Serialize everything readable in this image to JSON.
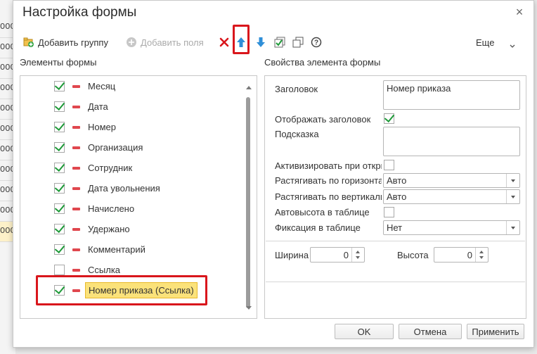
{
  "background": {
    "rows": [
      "OOC",
      "OOC",
      "OOC",
      "OOC",
      "OOC",
      "OOC",
      "OOC",
      "OOC",
      "OOC",
      "OOC",
      "OOC"
    ]
  },
  "dialog": {
    "title": "Настройка формы"
  },
  "toolbar": {
    "add_group": "Добавить группу",
    "add_fields": "Добавить поля",
    "more": "Еще",
    "icons": [
      "plus-folder-icon",
      "plus-circle-icon",
      "delete-x-icon",
      "move-up-arrow-icon",
      "move-down-arrow-icon",
      "check-all-icon",
      "copy-icon",
      "help-icon"
    ]
  },
  "left_panel": {
    "header": "Элементы формы",
    "items": [
      {
        "label": "Месяц",
        "checked": true
      },
      {
        "label": "Дата",
        "checked": true
      },
      {
        "label": "Номер",
        "checked": true
      },
      {
        "label": "Организация",
        "checked": true
      },
      {
        "label": "Сотрудник",
        "checked": true
      },
      {
        "label": "Дата увольнения",
        "checked": true
      },
      {
        "label": "Начислено",
        "checked": true
      },
      {
        "label": "Удержано",
        "checked": true
      },
      {
        "label": "Комментарий",
        "checked": true
      },
      {
        "label": "Ссылка",
        "checked": false
      },
      {
        "label": "Номер приказа (Ссылка)",
        "checked": true,
        "selected": true
      }
    ]
  },
  "right_panel": {
    "header": "Свойства элемента формы",
    "title_label": "Заголовок",
    "title_value": "Номер приказа",
    "show_title_label": "Отображать заголовок",
    "show_title_checked": true,
    "tooltip_label": "Подсказка",
    "tooltip_value": "",
    "activate_label": "Активизировать при откры",
    "activate_checked": false,
    "stretch_h_label": "Растягивать по горизонта",
    "stretch_h_value": "Авто",
    "stretch_v_label": "Растягивать по вертикали",
    "stretch_v_value": "Авто",
    "autoheight_label": "Автовысота в таблице",
    "autoheight_checked": false,
    "fix_label": "Фиксация в таблице",
    "fix_value": "Нет",
    "width_label": "Ширина",
    "width_value": "0",
    "height_label": "Высота",
    "height_value": "0"
  },
  "footer": {
    "ok": "OK",
    "cancel": "Отмена",
    "apply": "Применить"
  },
  "colors": {
    "highlight": "#d9161c",
    "selected_fill": "#fbe27a",
    "check": "#1f9a39",
    "dash": "#e0474e",
    "arrow_blue": "#2f8fd8"
  }
}
